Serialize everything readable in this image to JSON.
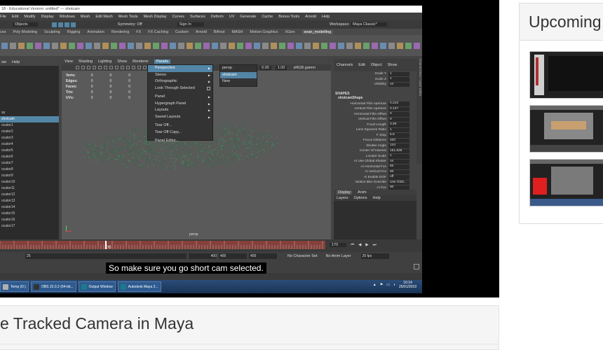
{
  "maya": {
    "title": "18 - Educational Version: untitled* --- shotcam",
    "menu": [
      "File",
      "Edit",
      "Modify",
      "Display",
      "Windows",
      "Mesh",
      "Edit Mesh",
      "Mesh Tools",
      "Mesh Display",
      "Curves",
      "Surfaces",
      "Deform",
      "UV",
      "Generate",
      "Cache",
      "Bonus Tools",
      "Arnold",
      "Help"
    ],
    "workspace_label": "Workspace :",
    "workspace_value": "Maya Classic*",
    "status_objects": "Objects",
    "symmetry": "Symmetry: Off",
    "sign_in": "Sign In",
    "shelf_tabs": [
      "ces",
      "Poly Modeling",
      "Sculpting",
      "Rigging",
      "Animation",
      "Rendering",
      "FX",
      "FX Caching",
      "Custom",
      "Arnold",
      "Bifrost",
      "MASH",
      "Motion Graphics",
      "XGen",
      "sean_modelling"
    ],
    "outliner_menu": [
      "ow",
      "Help"
    ],
    "outliner_items": [
      "",
      "",
      "",
      "",
      "",
      "",
      "",
      "sp",
      "shotcam",
      "ocator1",
      "ocator2",
      "ocator3",
      "ocator4",
      "ocator5",
      "ocator6",
      "ocator7",
      "ocator8",
      "ocator9",
      "ocator10",
      "ocator11",
      "ocator12",
      "ocator13",
      "ocator14",
      "ocator15",
      "ocator16",
      "ocator17"
    ],
    "viewport_menu": [
      "View",
      "Shading",
      "Lighting",
      "Show",
      "Renderer",
      "Panels"
    ],
    "viewport_value1": "0.00",
    "viewport_value2": "1.00",
    "viewport_colorspace": "sRGB gamm",
    "hud": [
      {
        "label": "Verts:",
        "a": "0",
        "b": "0",
        "c": "0"
      },
      {
        "label": "Edges:",
        "a": "0",
        "b": "0",
        "c": "0"
      },
      {
        "label": "Faces:",
        "a": "0",
        "b": "0",
        "c": "0"
      },
      {
        "label": "Tris:",
        "a": "0",
        "b": "0",
        "c": "0"
      },
      {
        "label": "UVs:",
        "a": "0",
        "b": "0",
        "c": "0"
      }
    ],
    "camera_label": "persp",
    "panels_menu": [
      "Perspective",
      "Stereo",
      "Orthographic",
      "Look Through Selected",
      "Panel",
      "Hypergraph Panel",
      "Layouts",
      "Saved Layouts",
      "Tear Off...",
      "Tear Off Copy...",
      "Panel Editor..."
    ],
    "submenu": [
      "persp",
      "shotcam",
      "New"
    ],
    "channel_menu": [
      "Channels",
      "Edit",
      "Object",
      "Show"
    ],
    "channel_top": [
      {
        "k": "Scale Y",
        "v": "1"
      },
      {
        "k": "Scale Z",
        "v": "1"
      },
      {
        "k": "Visibility",
        "v": "on"
      }
    ],
    "shapes_label": "SHAPES",
    "shape_name": "shotcamShape",
    "channels": [
      {
        "k": "Horizontal Film Aperture",
        "v": "0.243"
      },
      {
        "k": "Vertical Film Aperture",
        "v": "0.137"
      },
      {
        "k": "Horizontal Film Offset",
        "v": "0"
      },
      {
        "k": "Vertical Film Offset",
        "v": "0"
      },
      {
        "k": "Focal Length",
        "v": "3.29"
      },
      {
        "k": "Lens Squeeze Ratio",
        "v": "1"
      },
      {
        "k": "F Stop",
        "v": "5.6"
      },
      {
        "k": "Focus Distance",
        "v": "200"
      },
      {
        "k": "Shutter Angle",
        "v": "144"
      },
      {
        "k": "Center Of Interest",
        "v": "151.628"
      },
      {
        "k": "Locator Scale",
        "v": "1"
      },
      {
        "k": "Ai Use Global Shutter",
        "v": "on"
      },
      {
        "k": "Ai Horizontal Fov",
        "v": "60"
      },
      {
        "k": "Ai Vertical Fov",
        "v": "90"
      },
      {
        "k": "Ai Enable DOF",
        "v": "off"
      },
      {
        "k": "Motion Blur Override",
        "v": "Use Glob..."
      },
      {
        "k": "Ai Fov",
        "v": "90"
      }
    ],
    "layer_tabs": [
      "Display",
      "Anim"
    ],
    "layer_menu": [
      "Layers",
      "Options",
      "Help"
    ],
    "side_labels": "Channel Box / Layer Editor",
    "time_current": "170",
    "timeline_marker": "170",
    "range_start": "25",
    "range_fields": [
      "400",
      "400",
      "400"
    ],
    "no_character": "No Character Set",
    "no_anim_layer": "No Anim Layer",
    "fps": "25 fps",
    "taskbar_items": [
      "Temp (D:)",
      "OBS 22.0.2 (64-bit...",
      "Output Window",
      "Autodesk Maya 2..."
    ],
    "clock_time": "10:14",
    "clock_date": "25/01/2019",
    "colors": {
      "highlight": "#5285a6",
      "particles": "#2f6b45",
      "timeline_red": "#b3342c"
    }
  },
  "subtitle": "So make sure you go short cam selected.",
  "video_title": "e Tracked Camera in Maya",
  "sidebar": {
    "title": "Upcoming"
  }
}
